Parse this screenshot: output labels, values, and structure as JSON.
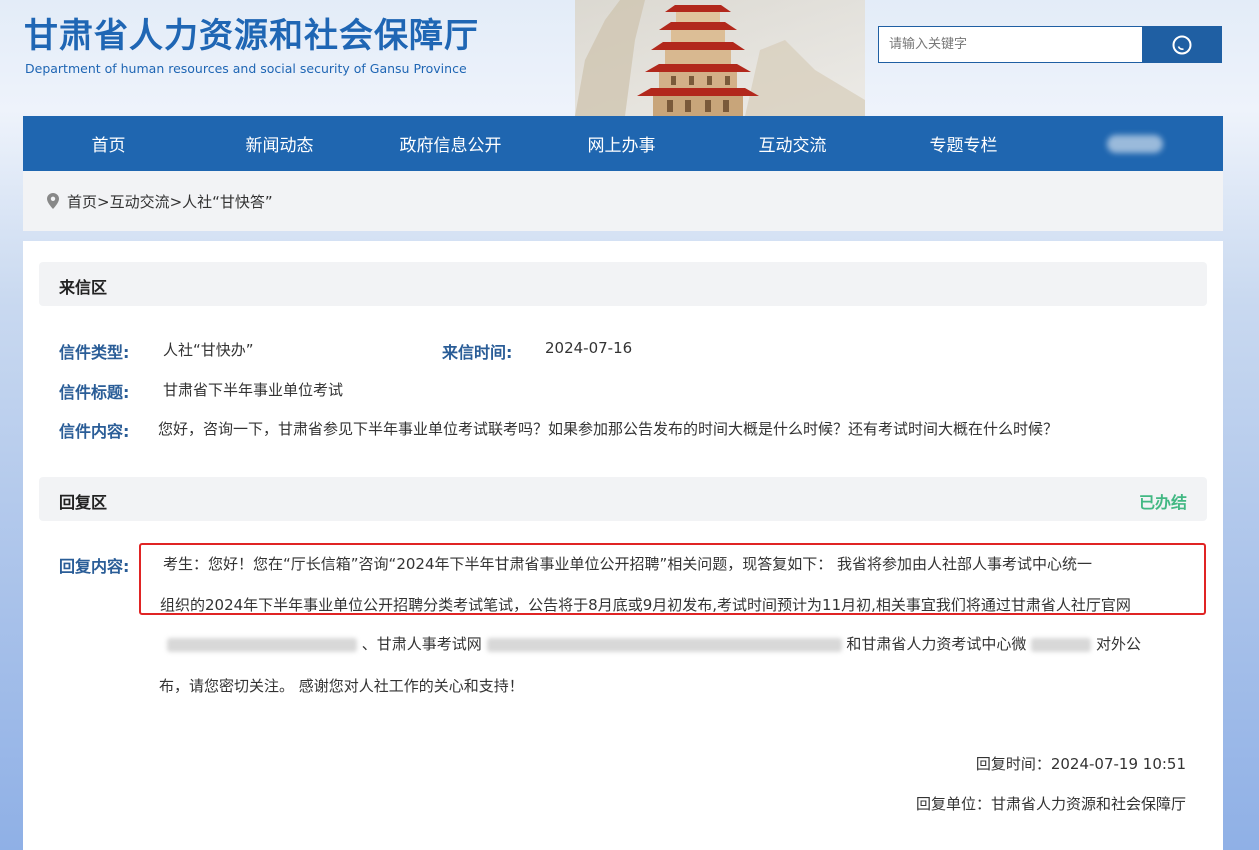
{
  "header": {
    "title_cn": "甘肃省人力资源和社会保障厅",
    "title_en": "Department of human resources and social security of Gansu Province"
  },
  "search": {
    "placeholder": "请输入关键字",
    "icon": "search-icon"
  },
  "nav": {
    "items": [
      "首页",
      "新闻动态",
      "政府信息公开",
      "网上办事",
      "互动交流",
      "专题专栏"
    ]
  },
  "breadcrumb": {
    "icon": "location-pin-icon",
    "text": "首页>互动交流>人社“甘快答”"
  },
  "letter": {
    "section_title": "来信区",
    "type_label": "信件类型:",
    "type_value": "人社“甘快办”",
    "time_label": "来信时间:",
    "time_value": "2024-07-16",
    "title_label": "信件标题:",
    "title_value": "甘肃省下半年事业单位考试",
    "content_label": "信件内容:",
    "content_value": "您好，咨询一下，甘肃省参见下半年事业单位考试联考吗？如果参加那公告发布的时间大概是什么时候？还有考试时间大概在什么时候？"
  },
  "reply": {
    "section_title": "回复区",
    "status": "已办结",
    "content_label": "回复内容:",
    "line1": "考生：您好！您在“厅长信箱”咨询“2024年下半年甘肃省事业单位公开招聘”相关问题，现答复如下：  我省将参加由人社部人事考试中心统一",
    "line2": "组织的2024年下半年事业单位公开招聘分类考试笔试，公告将于8月底或9月初发布,考试时间预计为11月初,相关事宜我们将通过甘肃省人社厅官网",
    "line3_a": "、甘肃人事考试网",
    "line3_b": "和甘肃省人力资考试中心微",
    "line3_c": "对外公",
    "line4": "布，请您密切关注。 感谢您对人社工作的关心和支持！",
    "reply_time": "回复时间：2024-07-19 10:51",
    "reply_unit": "回复单位：甘肃省人力资源和社会保障厅"
  },
  "colors": {
    "brand_blue": "#1f66b0",
    "label_blue": "#2a5d97",
    "status_green": "#42b883",
    "highlight_red": "#e02424"
  }
}
